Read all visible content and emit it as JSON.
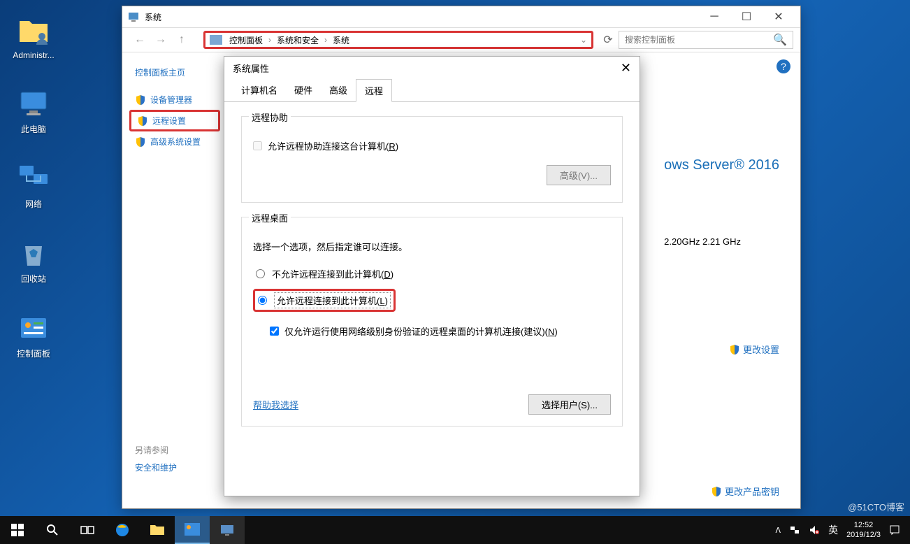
{
  "desktop": {
    "icons": [
      {
        "name": "administrator-folder",
        "label": "Administr..."
      },
      {
        "name": "this-pc",
        "label": "此电脑"
      },
      {
        "name": "network",
        "label": "网络"
      },
      {
        "name": "recycle-bin",
        "label": "回收站"
      },
      {
        "name": "control-panel",
        "label": "控制面板"
      }
    ]
  },
  "window": {
    "title": "系统",
    "breadcrumb": [
      "控制面板",
      "系统和安全",
      "系统"
    ],
    "search_placeholder": "搜索控制面板",
    "sidebar": {
      "title": "控制面板主页",
      "items": [
        {
          "label": "设备管理器",
          "h": false
        },
        {
          "label": "远程设置",
          "h": true
        },
        {
          "label": "高级系统设置",
          "h": false
        }
      ],
      "see_also": "另请参阅",
      "see_link": "安全和维护"
    },
    "main": {
      "os": "ows Server® 2016",
      "hw": "2.20GHz   2.21 GHz",
      "change": "更改设置",
      "product_key": "更改产品密钥"
    }
  },
  "dialog": {
    "title": "系统属性",
    "tabs": [
      "计算机名",
      "硬件",
      "高级",
      "远程"
    ],
    "active_tab": 3,
    "remote_assist": {
      "legend": "远程协助",
      "checkbox": "允许远程协助连接这台计算机(R)",
      "adv_btn": "高级(V)..."
    },
    "remote_desktop": {
      "legend": "远程桌面",
      "instruction": "选择一个选项，然后指定谁可以连接。",
      "opt1": "不允许远程连接到此计算机(D)",
      "opt2": "允许远程连接到此计算机(L)",
      "nla": "仅允许运行使用网络级别身份验证的远程桌面的计算机连接(建议)(N)",
      "help": "帮助我选择",
      "select_users": "选择用户(S)..."
    }
  },
  "taskbar": {
    "ime": "英",
    "time": "12:52",
    "date": "2019/12/3"
  },
  "watermark": "@51CTO博客"
}
